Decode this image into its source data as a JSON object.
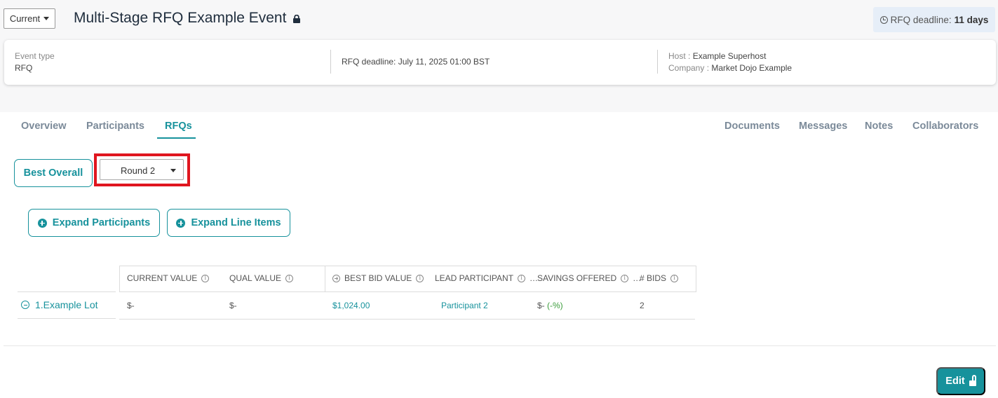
{
  "header": {
    "version_button": "Current",
    "title": "Multi-Stage RFQ Example Event",
    "deadline_chip_label": "RFQ deadline:",
    "deadline_chip_value": "11 days"
  },
  "info": {
    "event_type_label": "Event type",
    "event_type_value": "RFQ",
    "deadline_text": "RFQ deadline: July 11, 2025 01:00 BST",
    "host_label": "Host :",
    "host_value": "Example Superhost",
    "company_label": "Company :",
    "company_value": "Market Dojo Example"
  },
  "tabs": {
    "overview": "Overview",
    "participants": "Participants",
    "rfqs": "RFQs",
    "documents": "Documents",
    "messages": "Messages",
    "notes": "Notes",
    "collaborators": "Collaborators"
  },
  "controls": {
    "best_overall": "Best Overall",
    "round_select_value": "Round 2",
    "expand_participants": "Expand Participants",
    "expand_line_items": "Expand Line Items"
  },
  "table": {
    "headers": {
      "current_value": "CURRENT VALUE",
      "qual_value": "QUAL VALUE",
      "best_bid_value": "BEST BID VALUE",
      "lead_participant": "LEAD PARTICIPANT",
      "savings_offered": "SAVINGS OFFERED",
      "bids": "# BIDS"
    },
    "rows": [
      {
        "lot": "1.Example Lot",
        "current_value": "$-",
        "qual_value": "$-",
        "best_bid_value": "$1,024.00",
        "lead_participant": "Participant 2",
        "savings_prefix": "$-",
        "savings_pct": "(-%)",
        "bids": "2"
      }
    ]
  },
  "footer": {
    "edit_button": "Edit"
  },
  "colors": {
    "accent": "#17929c",
    "highlight": "#e0161f"
  }
}
